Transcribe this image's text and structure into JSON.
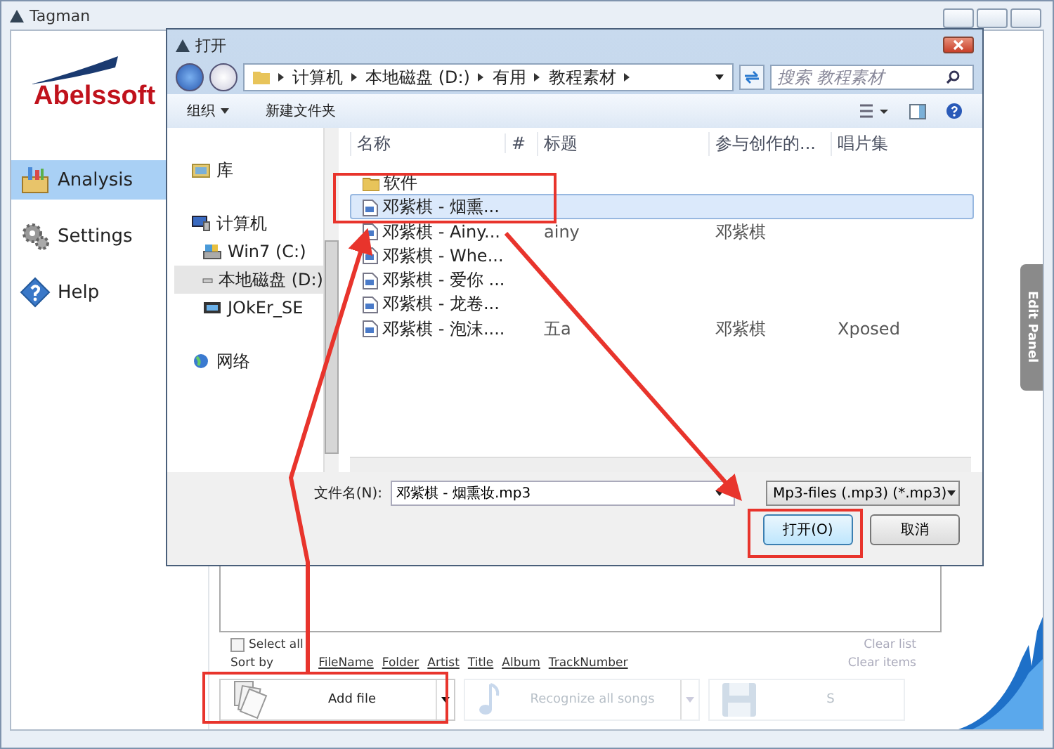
{
  "window": {
    "title": "Tagman"
  },
  "logo": {
    "text": "Abelssoft"
  },
  "sidebar": {
    "items": [
      {
        "kind": "analysis",
        "label": "Analysis",
        "selected": true
      },
      {
        "kind": "settings",
        "label": "Settings",
        "selected": false
      },
      {
        "kind": "help",
        "label": "Help",
        "selected": false
      }
    ]
  },
  "list_controls": {
    "select_all": {
      "label": "Select all",
      "checked": false
    },
    "sort_label": "Sort by",
    "sort_options": [
      "FileName",
      "Folder",
      "Artist",
      "Title",
      "Album",
      "TrackNumber"
    ],
    "clear_list": "Clear list",
    "clear_items": "Clear items"
  },
  "toolbar": [
    {
      "kind": "add",
      "label": "Add file",
      "disabled": false
    },
    {
      "kind": "recognize",
      "label": "Recognize all songs",
      "disabled": true
    },
    {
      "kind": "save",
      "label": "S",
      "disabled": true
    }
  ],
  "edit_panel_tab": "Edit Panel",
  "dialog": {
    "title": "打开",
    "breadcrumb": [
      "计算机",
      "本地磁盘 (D:)",
      "有用",
      "教程素材"
    ],
    "search": {
      "placeholder": "搜索 教程素材"
    },
    "commands": [
      "组织",
      "新建文件夹"
    ],
    "nav": [
      {
        "kind": "library",
        "label": "库",
        "selected": false
      },
      {
        "kind": "computer",
        "label": "计算机",
        "selected": false,
        "children": [
          {
            "kind": "drive",
            "label": "Win7 (C:)",
            "selected": false
          },
          {
            "kind": "disk",
            "label": "本地磁盘 (D:)",
            "selected": true
          },
          {
            "kind": "media",
            "label": "JOkEr_SE",
            "selected": false
          }
        ]
      },
      {
        "kind": "network",
        "label": "网络",
        "selected": false
      }
    ],
    "columns": [
      "名称",
      "#",
      "标题",
      "参与创作的...",
      "唱片集"
    ],
    "files": [
      {
        "kind": "folder",
        "name": "软件",
        "selected": false
      },
      {
        "kind": "audio",
        "name": "邓紫棋 - 烟熏...",
        "selected": true
      },
      {
        "kind": "audio",
        "name": "邓紫棋 - Ainy...",
        "title": "ainy",
        "artist": "邓紫棋",
        "selected": false
      },
      {
        "kind": "audio",
        "name": "邓紫棋 - Whe...",
        "selected": false
      },
      {
        "kind": "audio",
        "name": "邓紫棋 - 爱你 ...",
        "selected": false
      },
      {
        "kind": "audio",
        "name": "邓紫棋 - 龙卷...",
        "selected": false
      },
      {
        "kind": "audio",
        "name": "邓紫棋 - 泡沫....",
        "title": "五a",
        "artist": "邓紫棋",
        "album": "Xposed",
        "selected": false
      }
    ],
    "file_name": {
      "label": "文件名(N):",
      "value": "邓紫棋 - 烟熏妆.mp3"
    },
    "file_type": "Mp3-files (.mp3) (*.mp3)",
    "buttons": [
      {
        "label": "打开(O)",
        "default": true
      },
      {
        "label": "取消",
        "default": false
      }
    ]
  }
}
